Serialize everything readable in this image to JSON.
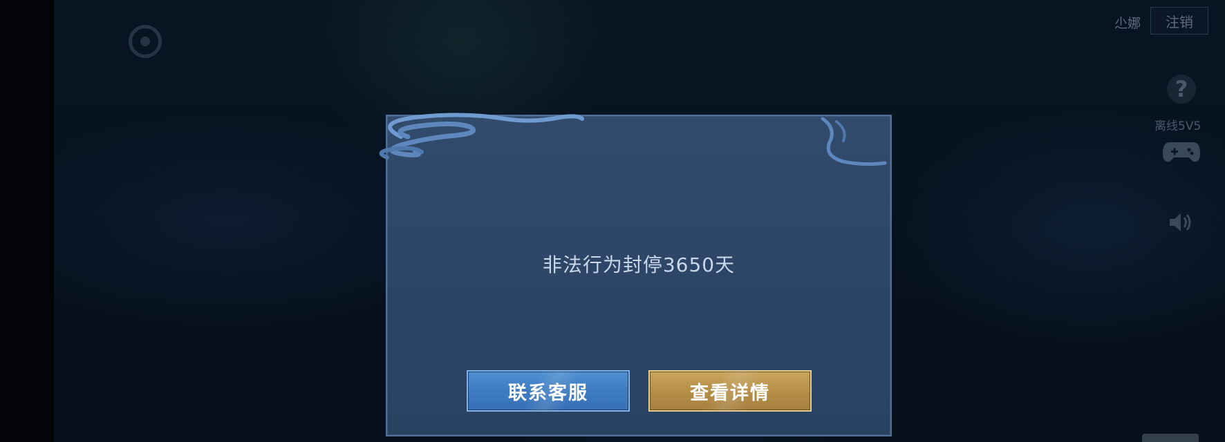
{
  "top_bar": {
    "username": "尐娜",
    "logout_label": "注销"
  },
  "side_menu": {
    "help_glyph": "?",
    "offline_label": "离线5V5"
  },
  "dialog": {
    "message": "非法行为封停3650天",
    "contact_label": "联系客服",
    "details_label": "查看详情"
  },
  "colors": {
    "dialog_bg": "#2e4668",
    "contact_button": "#3f7cc2",
    "details_button": "#b48d47"
  },
  "icons": [
    "logo-icon",
    "help-icon",
    "gamepad-icon",
    "sound-icon"
  ]
}
